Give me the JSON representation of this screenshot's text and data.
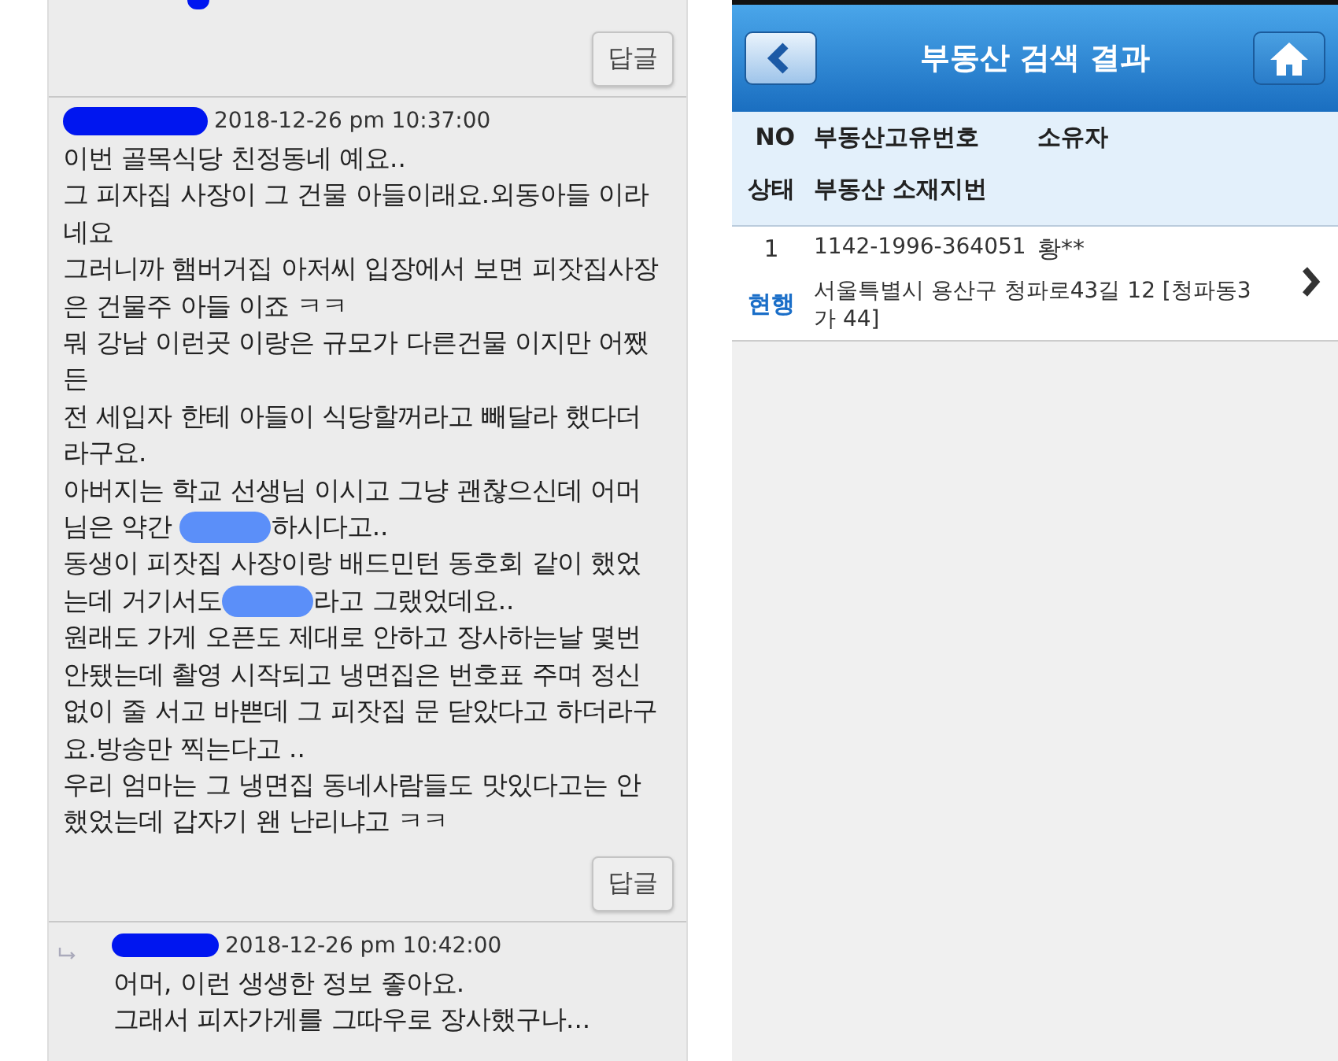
{
  "comments": {
    "top_reply_button": "답글",
    "items": [
      {
        "kind": "comment",
        "timestamp": "2018-12-26 pm 10:37:00",
        "reply_button": "답글",
        "lines": [
          [
            {
              "kind": "text",
              "text": "이번 골목식당 친정동네 예요.."
            }
          ],
          [
            {
              "kind": "text",
              "text": "그 피자집 사장이 그 건물 아들이래요.외동아들 이라"
            }
          ],
          [
            {
              "kind": "text",
              "text": "네요"
            }
          ],
          [
            {
              "kind": "text",
              "text": "그러니까 햄버거집 아저씨 입장에서 보면 피잣집사장"
            }
          ],
          [
            {
              "kind": "text",
              "text": "은 건물주 아들 이죠 ㅋㅋ"
            }
          ],
          [
            {
              "kind": "text",
              "text": "뭐 강남 이런곳 이랑은 규모가 다른건물 이지만 어쨌"
            }
          ],
          [
            {
              "kind": "text",
              "text": "든"
            }
          ],
          [
            {
              "kind": "text",
              "text": "전 세입자 한테 아들이 식당할꺼라고 빼달라 했다더"
            }
          ],
          [
            {
              "kind": "text",
              "text": "라구요."
            }
          ],
          [
            {
              "kind": "text",
              "text": "아버지는 학교 선생님 이시고 그냥 괜찮으신데 어머"
            }
          ],
          [
            {
              "kind": "text",
              "text": "님은 약간 "
            },
            {
              "kind": "redaction"
            },
            {
              "kind": "text",
              "text": "하시다고.."
            }
          ],
          [
            {
              "kind": "text",
              "text": "동생이 피잣집 사장이랑 배드민턴 동호회 같이 했었"
            }
          ],
          [
            {
              "kind": "text",
              "text": "는데 거기서도"
            },
            {
              "kind": "redaction"
            },
            {
              "kind": "text",
              "text": "라고 그랬었데요.."
            }
          ],
          [
            {
              "kind": "text",
              "text": "원래도 가게 오픈도 제대로 안하고 장사하는날 몇번"
            }
          ],
          [
            {
              "kind": "text",
              "text": "안됐는데 촬영 시작되고 냉면집은 번호표 주며 정신"
            }
          ],
          [
            {
              "kind": "text",
              "text": "없이 줄 서고 바쁜데 그 피잣집 문 닫았다고 하더라구"
            }
          ],
          [
            {
              "kind": "text",
              "text": "요.방송만 찍는다고 .."
            }
          ],
          [
            {
              "kind": "text",
              "text": "우리 엄마는 그 냉면집 동네사람들도 맛있다고는 안"
            }
          ],
          [
            {
              "kind": "text",
              "text": "했었는데 갑자기 왠 난리냐고 ㅋㅋ"
            }
          ]
        ]
      },
      {
        "kind": "reply",
        "timestamp": "2018-12-26 pm 10:42:00",
        "lines": [
          [
            {
              "kind": "text",
              "text": "어머, 이런 생생한 정보 좋아요."
            }
          ],
          [
            {
              "kind": "text",
              "text": "그래서 피자가게를 그따우로 장사했구나..."
            }
          ]
        ]
      }
    ]
  },
  "search_result": {
    "title": "부동산 검색 결과",
    "columns": [
      [
        "NO",
        "부동산고유번호",
        "소유자"
      ],
      [
        "상태",
        "부동산 소재지번"
      ]
    ],
    "rows": [
      {
        "no": "1",
        "number": "1142-1996-364051",
        "owner": "황**",
        "status": "현행",
        "address": "서울특별시 용산구 청파로43길 12 [청파동3가 44]"
      }
    ]
  }
}
